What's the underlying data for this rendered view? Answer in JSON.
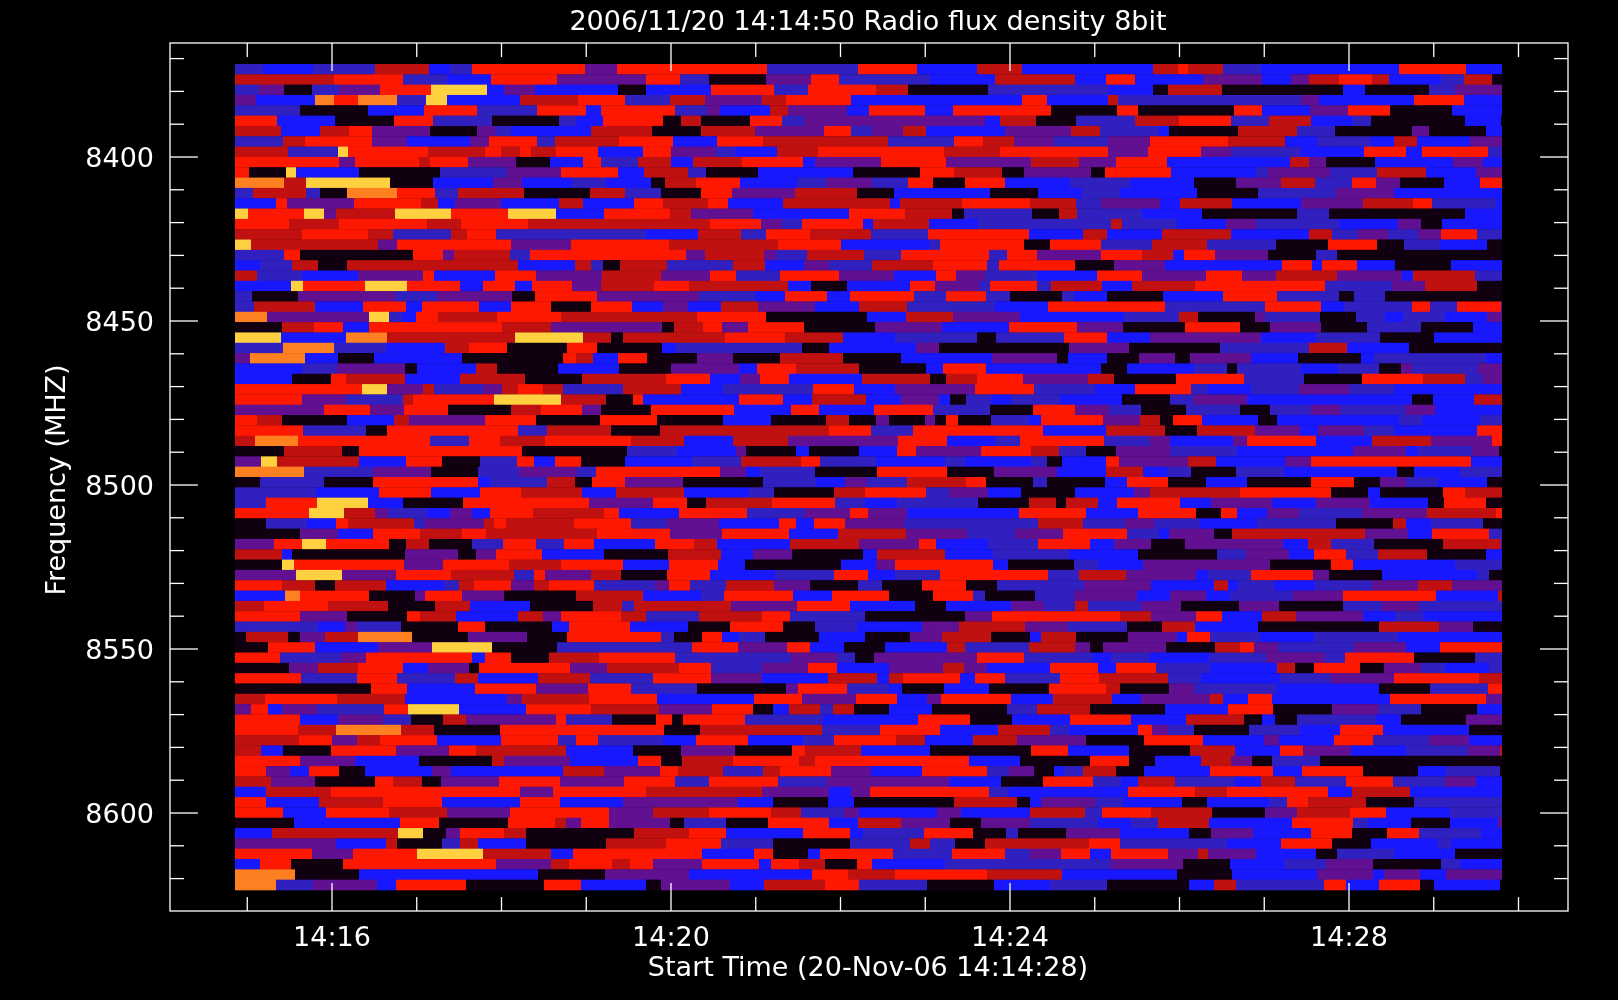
{
  "title": "2006/11/20 14:14:50 Radio flux density 8bit",
  "y_axis": {
    "label": "Frequency (MHZ)",
    "ticks": [
      "8400",
      "8450",
      "8500",
      "8550",
      "8600"
    ]
  },
  "x_axis": {
    "label": "Start Time (20-Nov-06 14:14:28)",
    "ticks": [
      "14:16",
      "14:20",
      "14:24",
      "14:28"
    ]
  }
}
